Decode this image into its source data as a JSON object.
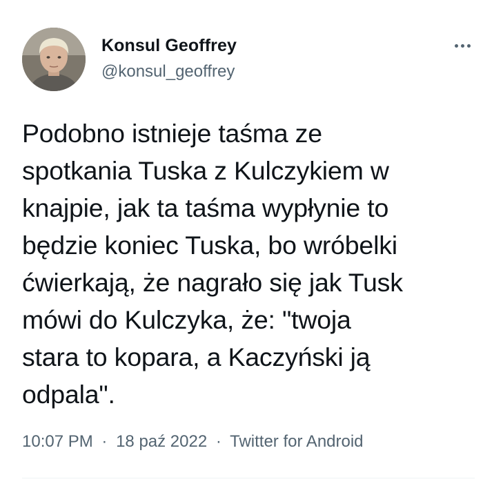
{
  "author": {
    "name": "Konsul Geoffrey",
    "handle": "@konsul_geoffrey"
  },
  "tweet": {
    "text": "Podobno istnieje taśma ze\nspotkania Tuska z Kulczykiem w\nknajpie, jak ta taśma wypłynie to\nbędzie koniec Tuska, bo wróbelki\nćwierkają, że nagrało się jak Tusk\nmówi do Kulczyka, że: \"twoja\nstara to kopara, a Kaczyński ją\nodpala\"."
  },
  "meta": {
    "time": "10:07 PM",
    "separator": "·",
    "date": "18 paź 2022",
    "source": "Twitter for Android"
  },
  "icons": {
    "more": "more-horizontal-icon"
  },
  "colors": {
    "text": "#0f1419",
    "secondary": "#536471",
    "divider": "#eff3f4"
  }
}
